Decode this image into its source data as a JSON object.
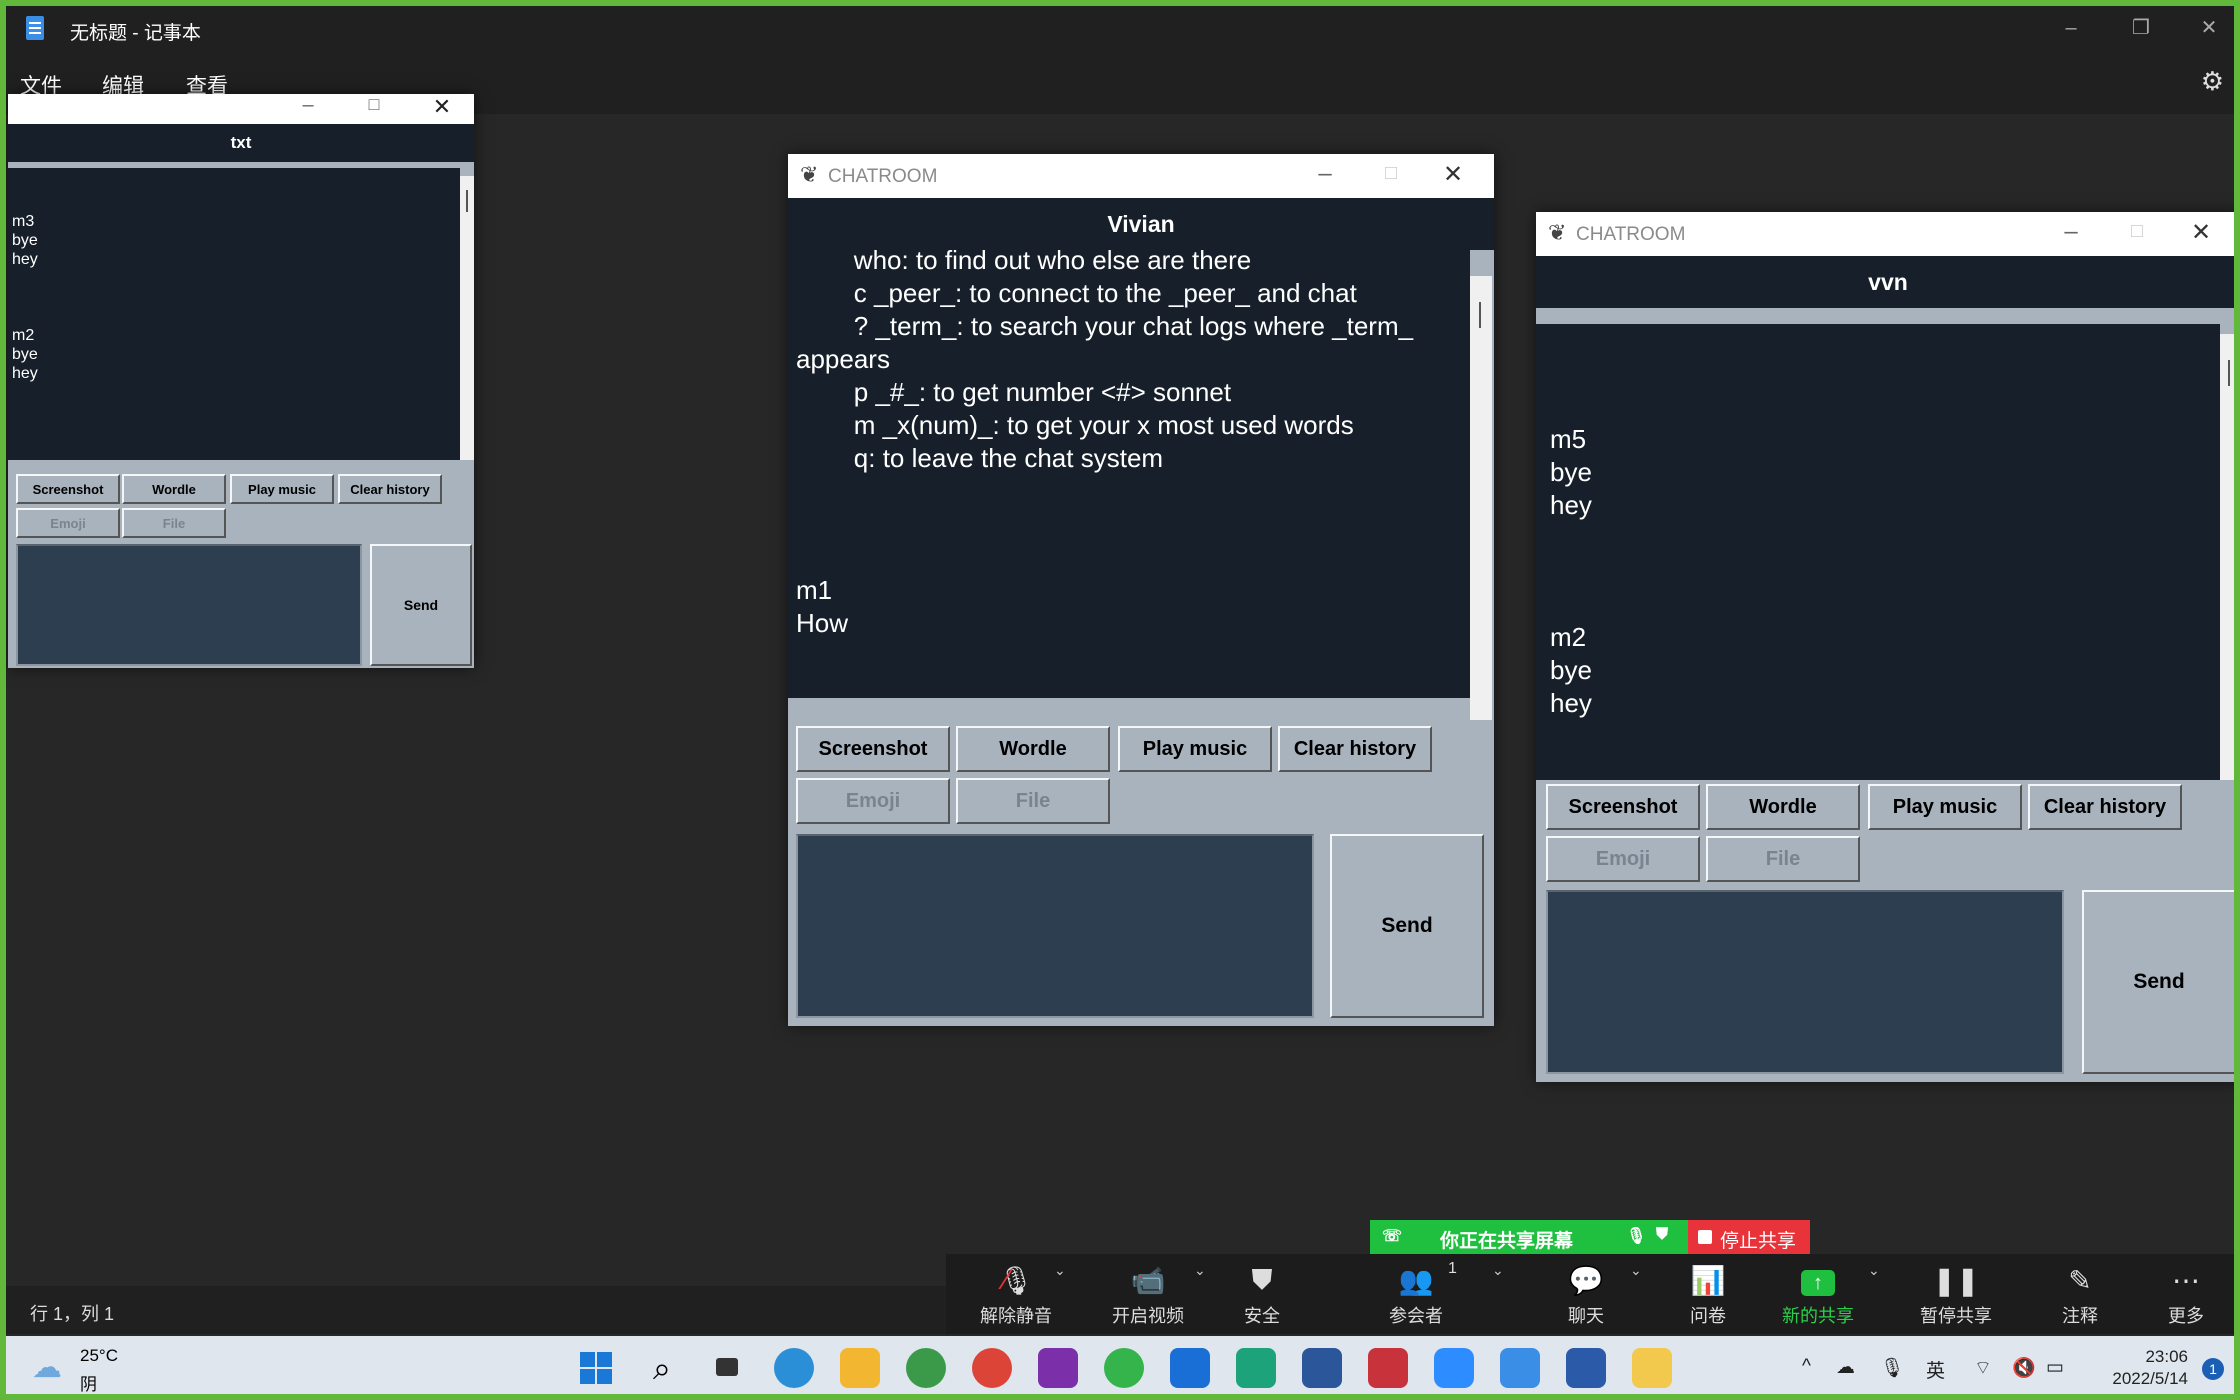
{
  "notepad": {
    "title": "无标题 - 记事本",
    "menu": [
      "文件",
      "编辑",
      "查看"
    ],
    "status": "行 1，列 1"
  },
  "win_left": {
    "title": "",
    "name": "txt",
    "log": "\n\nm3\nbye\nhey\n\n\n\nm2\nbye\nhey",
    "buttons": [
      "Screenshot",
      "Wordle",
      "Play music",
      "Clear history"
    ],
    "buttons2": [
      "Emoji",
      "File"
    ],
    "send": "Send"
  },
  "win_mid": {
    "title": "CHATROOM",
    "name": "Vivian",
    "log": "        who: to find out who else are there\n        c _peer_: to connect to the _peer_ and chat\n        ? _term_: to search your chat logs where _term_\nappears\n        p _#_: to get number <#> sonnet\n        m _x(num)_: to get your x most used words\n        q: to leave the chat system\n\n\n\nm1\nHow",
    "buttons": [
      "Screenshot",
      "Wordle",
      "Play music",
      "Clear history"
    ],
    "buttons2": [
      "Emoji",
      "File"
    ],
    "send": "Send"
  },
  "win_right": {
    "title": "CHATROOM",
    "name": "vvn",
    "log": "\n\n\nm5\nbye\nhey\n\n\n\nm2\nbye\nhey",
    "buttons": [
      "Screenshot",
      "Wordle",
      "Play music",
      "Clear history"
    ],
    "buttons2": [
      "Emoji",
      "File"
    ],
    "send": "Send"
  },
  "zoom": {
    "sharing_text": "你正在共享屏幕",
    "stop_text": "停止共享",
    "participant_count": "1",
    "buttons": [
      {
        "label": "解除静音",
        "icon": "mic-muted-icon"
      },
      {
        "label": "开启视频",
        "icon": "video-off-icon"
      },
      {
        "label": "安全",
        "icon": "shield-icon"
      },
      {
        "label": "参会者",
        "icon": "participants-icon"
      },
      {
        "label": "聊天",
        "icon": "chat-icon"
      },
      {
        "label": "问卷",
        "icon": "poll-icon"
      },
      {
        "label": "新的共享",
        "icon": "share-screen-icon"
      },
      {
        "label": "暂停共享",
        "icon": "pause-icon"
      },
      {
        "label": "注释",
        "icon": "annotate-icon"
      },
      {
        "label": "更多",
        "icon": "more-icon"
      }
    ]
  },
  "taskbar": {
    "weather_temp": "25°C",
    "weather_desc": "阴",
    "ime": "英",
    "time": "23:06",
    "date": "2022/5/14",
    "notification_count": "1"
  },
  "colors": {
    "chat_bg": "#17202a",
    "panel_bg": "#a8b3be",
    "entry_bg": "#2c3e50",
    "share_green": "#1fbf3f",
    "share_red": "#e8333a"
  }
}
